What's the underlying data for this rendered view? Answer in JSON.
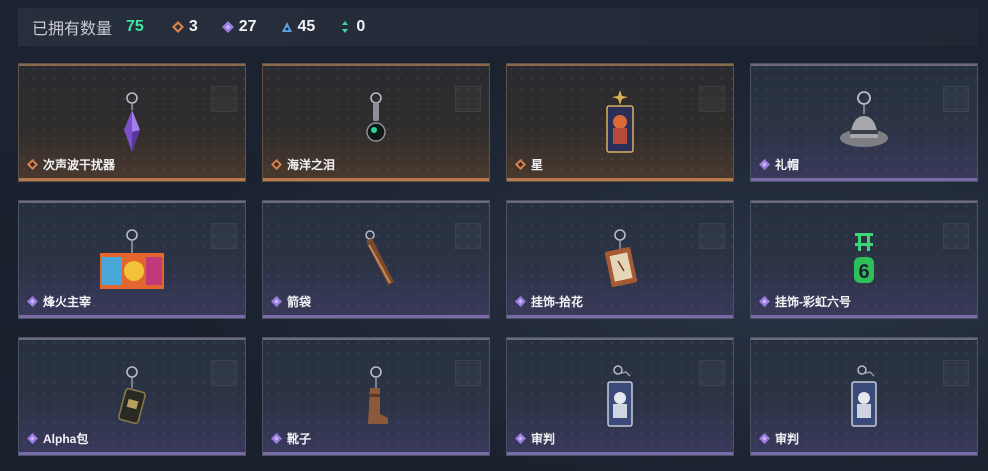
{
  "header": {
    "owned_label": "已拥有数量",
    "owned_count": "75",
    "stats": [
      {
        "icon": "orange-diamond-icon",
        "color": "#d9814a",
        "value": "3"
      },
      {
        "icon": "purple-diamond-icon",
        "color": "#9b7be0",
        "value": "27"
      },
      {
        "icon": "blue-triangle-icon",
        "color": "#5aa4e6",
        "value": "45"
      },
      {
        "icon": "green-arrows-icon",
        "color": "#3ed6a6",
        "value": "0"
      }
    ]
  },
  "items": [
    {
      "name": "次声波干扰器",
      "rarity": "orange",
      "charm": "purple-crystal"
    },
    {
      "name": "海洋之泪",
      "rarity": "orange",
      "charm": "dark-gem"
    },
    {
      "name": "星",
      "rarity": "orange",
      "charm": "tarot-star"
    },
    {
      "name": "礼帽",
      "rarity": "purple",
      "charm": "hat"
    },
    {
      "name": "烽火主宰",
      "rarity": "purple",
      "charm": "graffiti-plate"
    },
    {
      "name": "箭袋",
      "rarity": "purple",
      "charm": "quiver"
    },
    {
      "name": "挂饰-拾花",
      "rarity": "purple",
      "charm": "flower-card"
    },
    {
      "name": "挂饰-彩虹六号",
      "rarity": "purple",
      "charm": "six-logo"
    },
    {
      "name": "Alpha包",
      "rarity": "purple",
      "charm": "pack"
    },
    {
      "name": "靴子",
      "rarity": "purple",
      "charm": "boot"
    },
    {
      "name": "审判",
      "rarity": "purple",
      "charm": "tarot-judgement"
    },
    {
      "name": "审判",
      "rarity": "purple",
      "charm": "tarot-judgement"
    }
  ],
  "colors": {
    "owned_count": "#3ee6a0",
    "orange_rarity": "#d9814a",
    "purple_rarity": "#9b7be0"
  }
}
